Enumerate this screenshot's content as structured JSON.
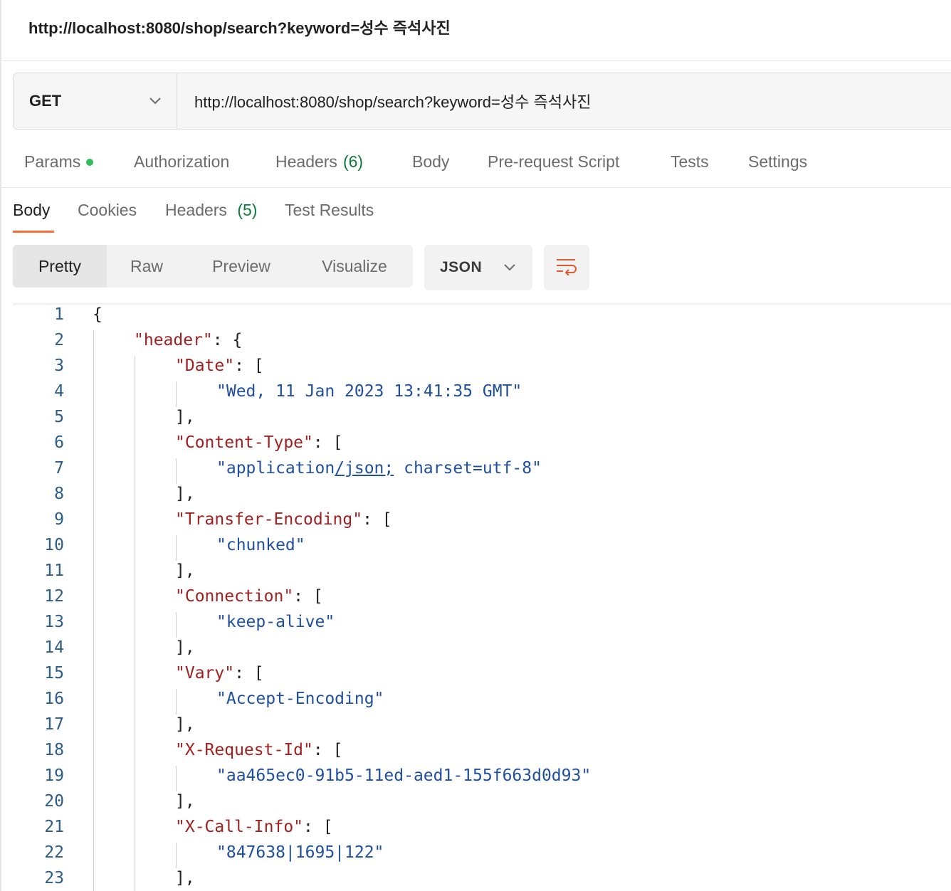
{
  "window": {
    "title": "http://localhost:8080/shop/search?keyword=성수 즉석사진"
  },
  "request": {
    "method": "GET",
    "url": "http://localhost:8080/shop/search?keyword=성수 즉석사진"
  },
  "request_tabs": [
    {
      "label": "Params",
      "count": "",
      "dot": true
    },
    {
      "label": "Authorization",
      "count": ""
    },
    {
      "label": "Headers",
      "count": "(6)"
    },
    {
      "label": "Body",
      "count": ""
    },
    {
      "label": "Pre-request Script",
      "count": ""
    },
    {
      "label": "Tests",
      "count": ""
    },
    {
      "label": "Settings",
      "count": ""
    }
  ],
  "response_tabs": [
    {
      "label": "Body",
      "count": "",
      "active": true
    },
    {
      "label": "Cookies",
      "count": ""
    },
    {
      "label": "Headers",
      "count": "(5)"
    },
    {
      "label": "Test Results",
      "count": ""
    }
  ],
  "view_modes": [
    {
      "label": "Pretty",
      "active": true
    },
    {
      "label": "Raw"
    },
    {
      "label": "Preview"
    },
    {
      "label": "Visualize"
    }
  ],
  "format": {
    "selected": "JSON"
  },
  "colors": {
    "accent": "#ff6c37",
    "key": "#a31f1f",
    "string": "#1e4fa3",
    "line_number": "#2b5c8a",
    "param_dot": "#2ebd59"
  },
  "code_lines": [
    {
      "n": "1",
      "text": "{"
    },
    {
      "n": "2",
      "key": "\"header\"",
      "rest": ": {"
    },
    {
      "n": "3",
      "key": "\"Date\"",
      "rest": ": ["
    },
    {
      "n": "4",
      "str": "\"Wed, 11 Jan 2023 13:41:35 GMT\""
    },
    {
      "n": "5",
      "text": "],"
    },
    {
      "n": "6",
      "key": "\"Content-Type\"",
      "rest": ": ["
    },
    {
      "n": "7",
      "str": "\"application",
      "link": "/json;",
      "str2": " charset=utf-8\""
    },
    {
      "n": "8",
      "text": "],"
    },
    {
      "n": "9",
      "key": "\"Transfer-Encoding\"",
      "rest": ": ["
    },
    {
      "n": "10",
      "str": "\"chunked\""
    },
    {
      "n": "11",
      "text": "],"
    },
    {
      "n": "12",
      "key": "\"Connection\"",
      "rest": ": ["
    },
    {
      "n": "13",
      "str": "\"keep-alive\""
    },
    {
      "n": "14",
      "text": "],"
    },
    {
      "n": "15",
      "key": "\"Vary\"",
      "rest": ": ["
    },
    {
      "n": "16",
      "str": "\"Accept-Encoding\""
    },
    {
      "n": "17",
      "text": "],"
    },
    {
      "n": "18",
      "key": "\"X-Request-Id\"",
      "rest": ": ["
    },
    {
      "n": "19",
      "str": "\"aa465ec0-91b5-11ed-aed1-155f663d0d93\""
    },
    {
      "n": "20",
      "text": "],"
    },
    {
      "n": "21",
      "key": "\"X-Call-Info\"",
      "rest": ": ["
    },
    {
      "n": "22",
      "str": "\"847638|1695|122\""
    },
    {
      "n": "23",
      "text": "],"
    }
  ]
}
